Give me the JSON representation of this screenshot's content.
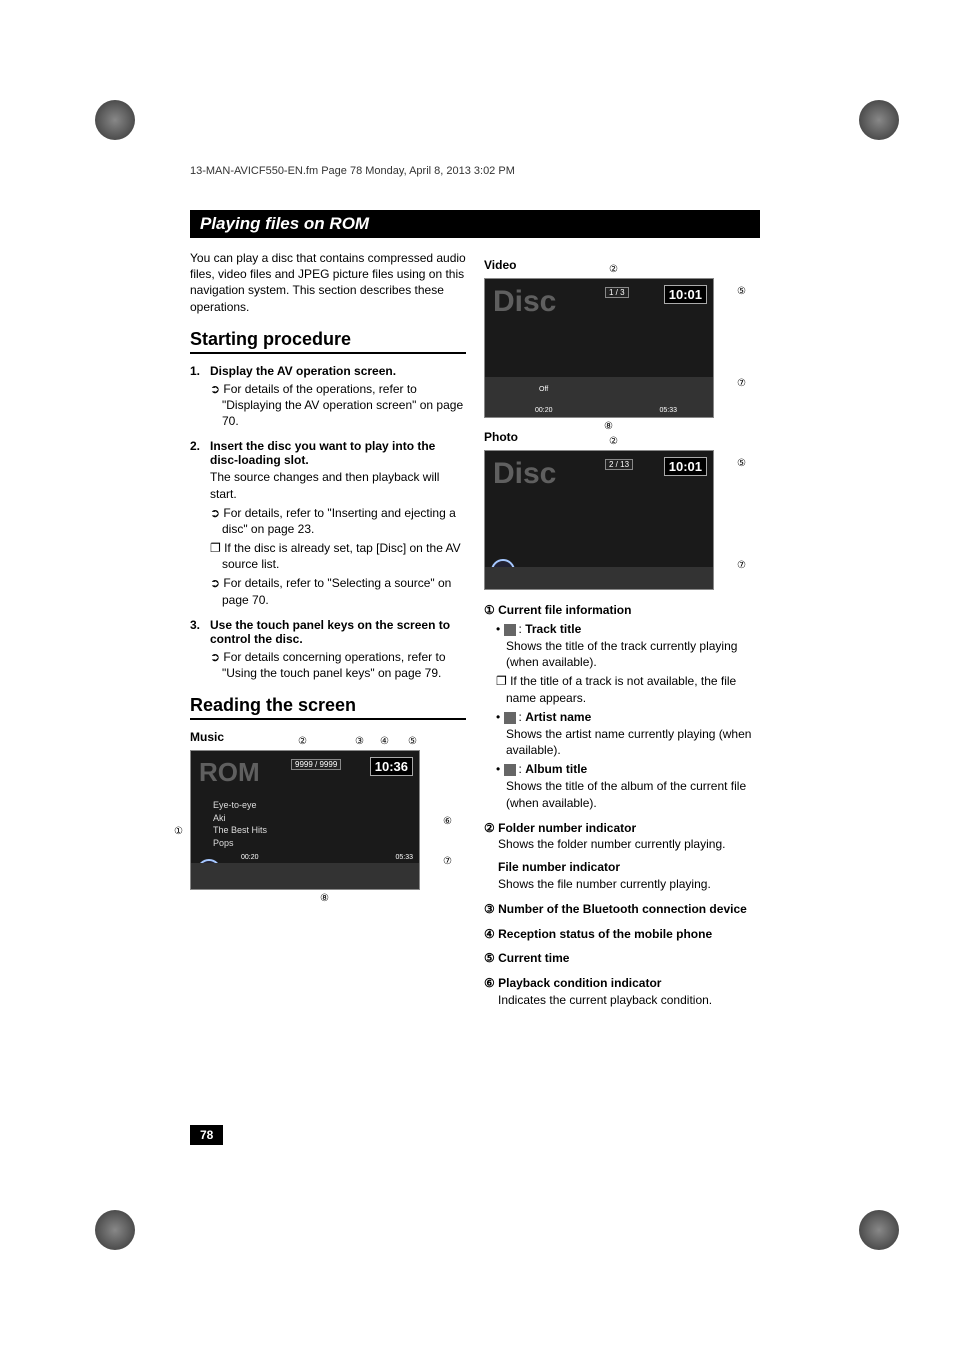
{
  "running_head": "13-MAN-AVICF550-EN.fm  Page 78  Monday, April 8, 2013  3:02 PM",
  "chapter_title": "Playing files on ROM",
  "intro": "You can play a disc that contains compressed audio files, video files and JPEG picture files using on this navigation system. This section describes these operations.",
  "sec1_title": "Starting procedure",
  "steps": [
    {
      "num": "1.",
      "head": "Display the AV operation screen.",
      "refs": [
        "➲ For details of the operations, refer to \"Displaying the AV operation screen\" on page 70."
      ]
    },
    {
      "num": "2.",
      "head": "Insert the disc you want to play into the disc-loading slot.",
      "body": "The source changes and then playback will start.",
      "refs": [
        "➲ For details, refer to \"Inserting and ejecting a disc\" on page 23.",
        "❐ If the disc is already set, tap [Disc] on the AV source list.",
        "➲ For details, refer to \"Selecting a source\" on page 70."
      ]
    },
    {
      "num": "3.",
      "head": "Use the touch panel keys on the screen to control the disc.",
      "refs": [
        "➲ For details concerning operations, refer to \"Using the touch panel keys\" on page 79."
      ]
    }
  ],
  "sec2_title": "Reading the screen",
  "music_label": "Music",
  "video_label": "Video",
  "photo_label": "Photo",
  "music_screen": {
    "source": "ROM",
    "clock": "10:36",
    "folder": "9999 / 9999",
    "tracks": [
      "Eye-to-eye",
      "Aki",
      "The Best Hits",
      "Pops"
    ],
    "elapsed": "00:20",
    "total": "05:33"
  },
  "video_screen": {
    "source": "Disc",
    "clock": "10:01",
    "folder": "1 / 3",
    "subtitle": "Off",
    "elapsed": "00:20",
    "total": "05:33"
  },
  "photo_screen": {
    "source": "Disc",
    "clock": "10:01",
    "folder": "2 / 13"
  },
  "callouts": {
    "c1": "①",
    "c2": "②",
    "c3": "③",
    "c4": "④",
    "c5": "⑤",
    "c6": "⑥",
    "c7": "⑦",
    "c8": "⑧"
  },
  "defs": [
    {
      "num": "①",
      "head": "Current file information",
      "items": [
        {
          "iconLabel": "Track title",
          "body": "Shows the title of the track currently playing (when available)."
        },
        {
          "note": "❐ If the title of a track is not available, the file name appears."
        },
        {
          "iconLabel": "Artist name",
          "body": "Shows the artist name currently playing (when available)."
        },
        {
          "iconLabel": "Album title",
          "body": "Shows the title of the album of the current file (when available)."
        }
      ]
    },
    {
      "num": "②",
      "head": "Folder number indicator",
      "body": "Shows the folder number currently playing.",
      "sub_head": "File number indicator",
      "sub_body": "Shows the file number currently playing."
    },
    {
      "num": "③",
      "head": "Number of the Bluetooth connection device"
    },
    {
      "num": "④",
      "head": "Reception status of the mobile phone"
    },
    {
      "num": "⑤",
      "head": "Current time"
    },
    {
      "num": "⑥",
      "head": "Playback condition indicator",
      "body": "Indicates the current playback condition."
    }
  ],
  "page_number": "78"
}
